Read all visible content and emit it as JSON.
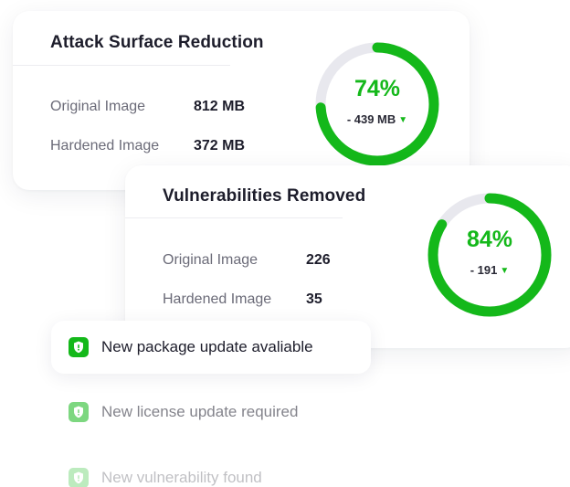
{
  "colors": {
    "accent": "#14b81a",
    "track": "#e8e8ee",
    "text": "#1d1d2b",
    "muted": "#6b6b78"
  },
  "attack_surface": {
    "title": "Attack Surface Reduction",
    "original_label": "Original Image",
    "original_value": "812 MB",
    "hardened_label": "Hardened Image",
    "hardened_value": "372 MB",
    "percent": "74%",
    "percent_value": 0.74,
    "delta": "- 439 MB"
  },
  "vulnerabilities": {
    "title": "Vulnerabilities Removed",
    "original_label": "Original Image",
    "original_value": "226",
    "hardened_label": "Hardened Image",
    "hardened_value": "35",
    "percent": "84%",
    "percent_value": 0.84,
    "delta": "- 191"
  },
  "notifications": [
    {
      "text": "New package update avaliable",
      "icon": "shield-icon"
    },
    {
      "text": "New license update required",
      "icon": "shield-icon"
    },
    {
      "text": "New vulnerability found",
      "icon": "shield-icon"
    }
  ]
}
